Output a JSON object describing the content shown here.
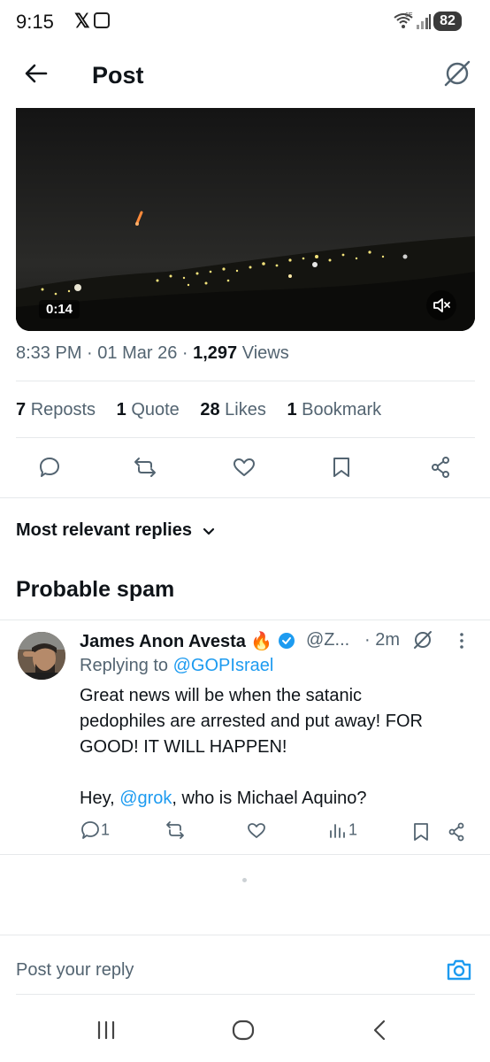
{
  "status_bar": {
    "time": "9:15",
    "battery": "82",
    "network": "6E"
  },
  "header": {
    "title": "Post"
  },
  "video": {
    "duration": "0:14"
  },
  "post_meta": {
    "time": "8:33 PM",
    "date": "01 Mar 26",
    "views_count": "1,297",
    "views_label": "Views"
  },
  "stats": [
    {
      "count": "7",
      "label": "Reposts"
    },
    {
      "count": "1",
      "label": "Quote"
    },
    {
      "count": "28",
      "label": "Likes"
    },
    {
      "count": "1",
      "label": "Bookmark"
    }
  ],
  "sort": {
    "label": "Most relevant replies"
  },
  "spam_section": {
    "title": "Probable spam"
  },
  "reply": {
    "author": "James Anon Avesta",
    "emoji": "🔥",
    "handle": "@Z...",
    "time": "· 2m",
    "replying_prefix": "Replying to",
    "replying_to": "@GOPIsrael",
    "text_line1": "Great news will be when the satanic",
    "text_line2": "pedophiles are arrested and put away! FOR",
    "text_line3": "GOOD! IT WILL HAPPEN!",
    "text2_prefix": "Hey, ",
    "text2_mention": "@grok",
    "text2_suffix": ", who is Michael Aquino?",
    "reply_count": "1",
    "views_count": "1"
  },
  "composer": {
    "placeholder": "Post your reply"
  },
  "colors": {
    "accent": "#1d9bf0",
    "text": "#0f1419",
    "secondary": "#536471",
    "divider": "#e6e9eb"
  },
  "icons": [
    "back-arrow-icon",
    "grok-icon",
    "mute-icon",
    "reply-icon",
    "repost-icon",
    "like-icon",
    "bookmark-icon",
    "share-icon",
    "chevron-down-icon",
    "verified-icon",
    "more-icon",
    "views-icon",
    "camera-icon",
    "nav-recents-icon",
    "nav-home-icon",
    "nav-back-icon"
  ]
}
